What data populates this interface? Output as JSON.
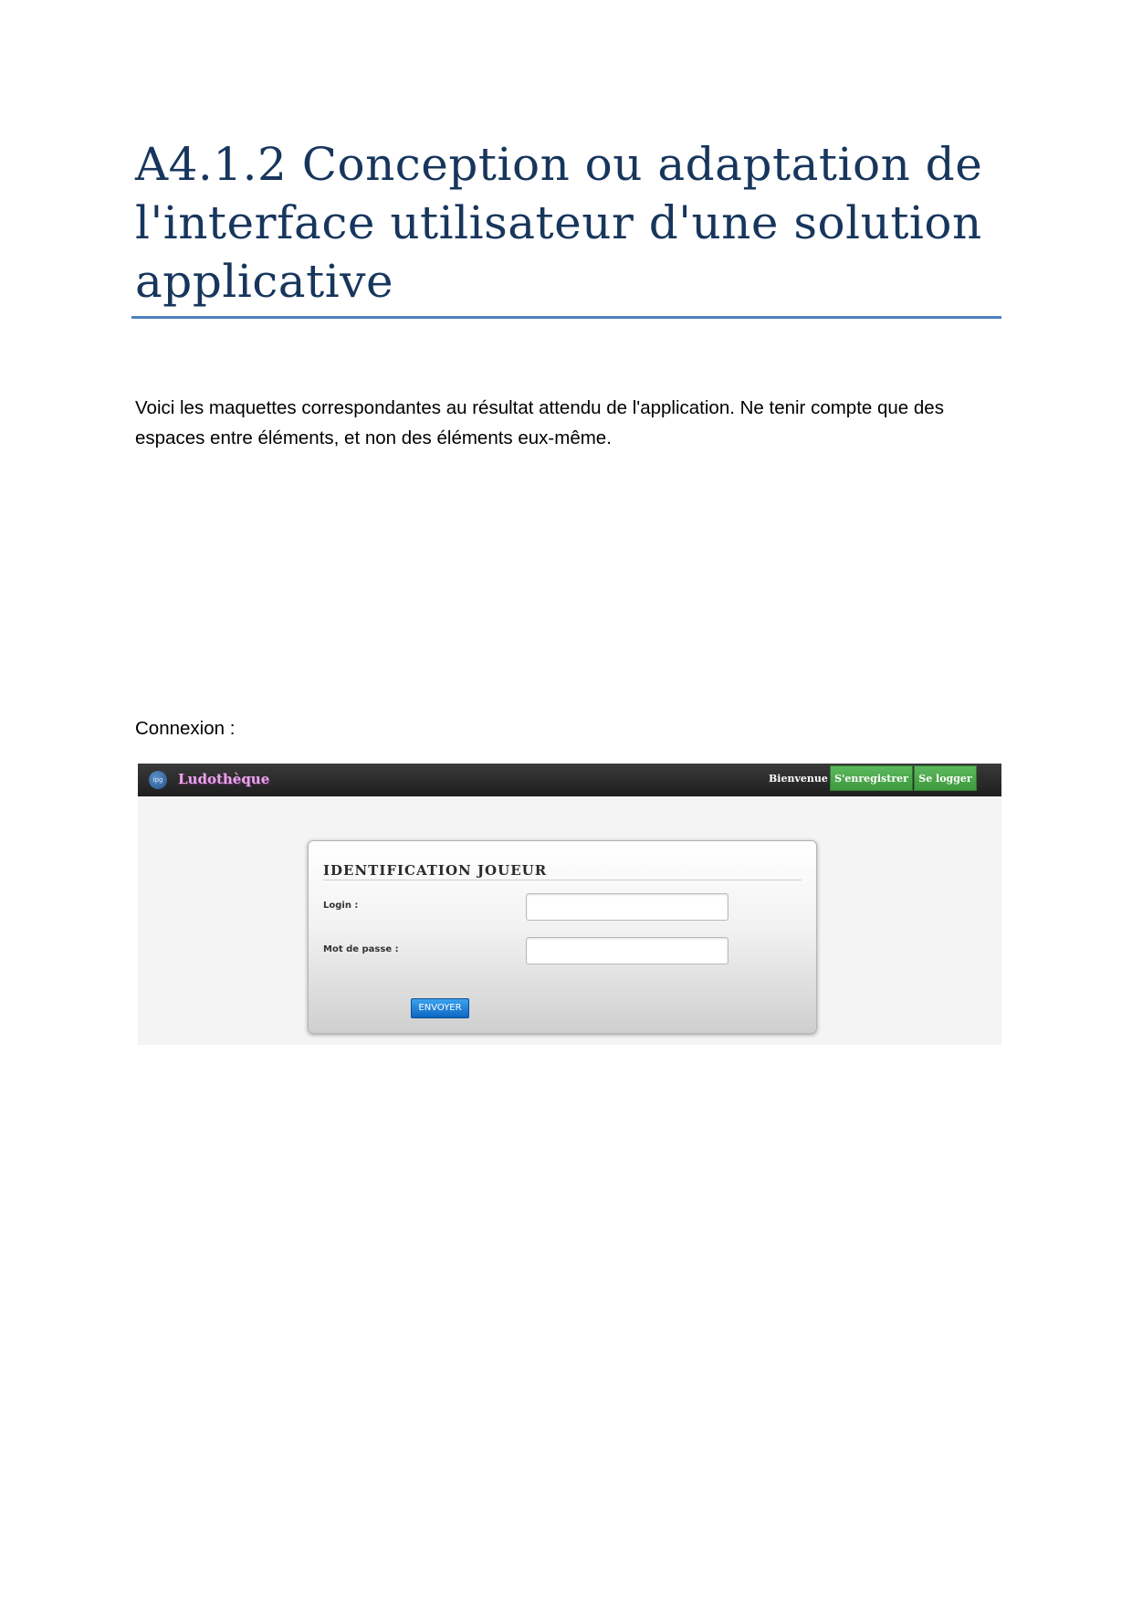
{
  "document": {
    "title": "A4.1.2 Conception ou adaptation de l'interface utilisateur d'une solution applicative",
    "intro": "Voici les maquettes correspondantes au résultat attendu de l'application. Ne tenir compte que des espaces entre éléments, et non des éléments eux-même.",
    "section_label": "Connexion :",
    "colors": {
      "title": "#17365d",
      "rule": "#4f81bd"
    }
  },
  "mockup": {
    "navbar": {
      "logo_text": "Ipg",
      "brand": "Ludothèque",
      "welcome": "Bienvenue !",
      "register_button": "S'enregistrer",
      "login_button": "Se logger",
      "colors": {
        "bar": "#2b2b2b",
        "brand": "#e7a6e8",
        "button": "#4cae4c"
      }
    },
    "form": {
      "title": "IDENTIFICATION JOUEUR",
      "login_label": "Login :",
      "login_value": "",
      "password_label": "Mot de passe :",
      "password_value": "",
      "submit_label": "ENVOYER",
      "colors": {
        "submit": "#1a7fd6"
      }
    }
  }
}
